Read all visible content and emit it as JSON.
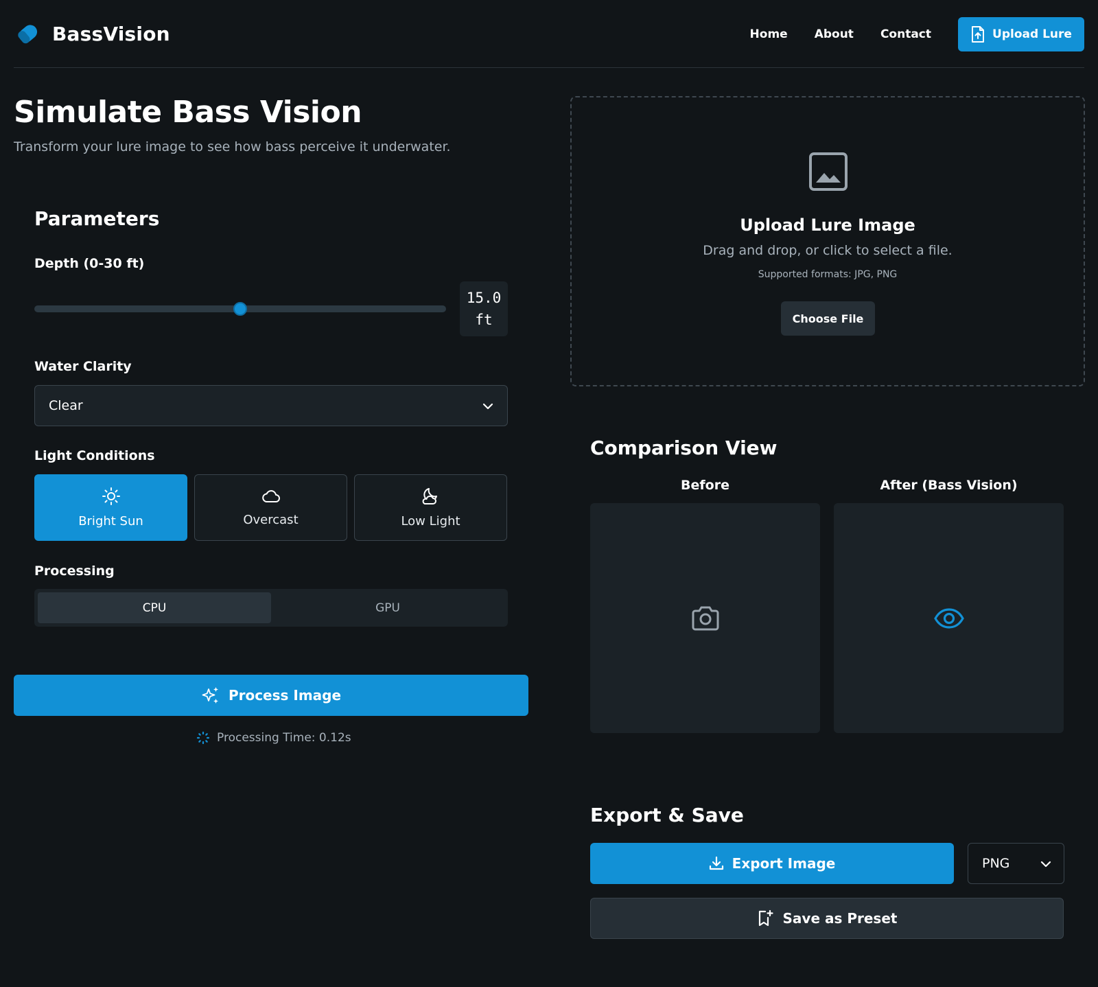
{
  "header": {
    "brand": "BassVision",
    "nav": [
      "Home",
      "About",
      "Contact"
    ],
    "upload_label": "Upload Lure"
  },
  "page": {
    "title": "Simulate Bass Vision",
    "subtitle": "Transform your lure image to see how bass perceive it underwater."
  },
  "parameters": {
    "title": "Parameters",
    "depth_label": "Depth (0-30 ft)",
    "depth_value": "15.0",
    "depth_unit": "ft",
    "depth_fraction": 0.5,
    "clarity_label": "Water Clarity",
    "clarity_value": "Clear",
    "light_label": "Light Conditions",
    "light_options": [
      "Bright Sun",
      "Overcast",
      "Low Light"
    ],
    "light_selected": "Bright Sun",
    "processing_label": "Processing",
    "processing_options": [
      "CPU",
      "GPU"
    ],
    "processing_selected": "CPU"
  },
  "process": {
    "button_label": "Process Image",
    "time_text": "Processing Time: 0.12s"
  },
  "upload_zone": {
    "title": "Upload Lure Image",
    "subtitle": "Drag and drop, or click to select a file.",
    "formats": "Supported formats: JPG, PNG",
    "choose_label": "Choose File"
  },
  "comparison": {
    "title": "Comparison View",
    "before_label": "Before",
    "after_label": "After (Bass Vision)"
  },
  "export": {
    "title": "Export & Save",
    "export_label": "Export Image",
    "format_value": "PNG",
    "preset_label": "Save as Preset"
  },
  "colors": {
    "background": "#111518",
    "accent": "#1291d6",
    "panel": "#1b2227",
    "muted_text": "#a8b2bb"
  }
}
